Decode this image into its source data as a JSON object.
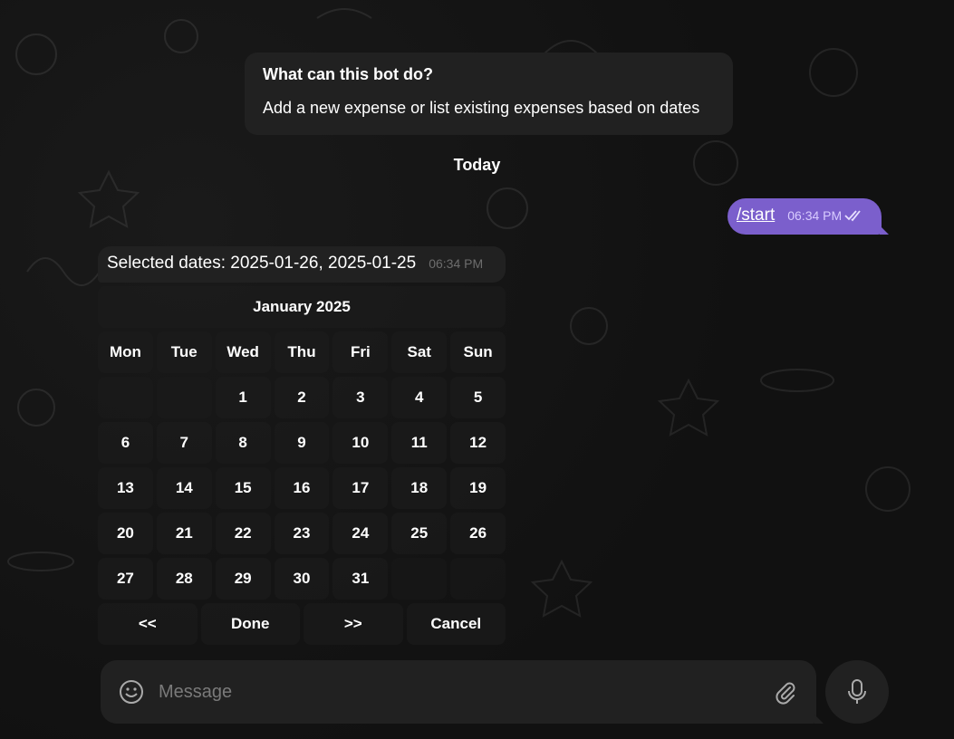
{
  "bot_intro": {
    "title": "What can this bot do?",
    "text": "Add a new expense or list existing expenses based on dates"
  },
  "date_separator": "Today",
  "outgoing_message": {
    "text": "/start",
    "time": "06:34 PM",
    "status": "read"
  },
  "incoming_message": {
    "text": "Selected dates: 2025-01-26, 2025-01-25",
    "time": "06:34 PM"
  },
  "calendar": {
    "month_label": "January 2025",
    "weekdays": [
      "Mon",
      "Tue",
      "Wed",
      "Thu",
      "Fri",
      "Sat",
      "Sun"
    ],
    "weeks": [
      [
        "",
        "",
        "1",
        "2",
        "3",
        "4",
        "5"
      ],
      [
        "6",
        "7",
        "8",
        "9",
        "10",
        "11",
        "12"
      ],
      [
        "13",
        "14",
        "15",
        "16",
        "17",
        "18",
        "19"
      ],
      [
        "20",
        "21",
        "22",
        "23",
        "24",
        "25",
        "26"
      ],
      [
        "27",
        "28",
        "29",
        "30",
        "31",
        "",
        ""
      ]
    ],
    "nav": {
      "prev": "<<",
      "done": "Done",
      "next": ">>",
      "cancel": "Cancel"
    }
  },
  "composer": {
    "placeholder": "Message",
    "value": ""
  },
  "colors": {
    "accent": "#7b5fcc",
    "bubble": "#212121",
    "background": "#0f0f0f"
  },
  "icons": {
    "emoji": "smile-icon",
    "attach": "paperclip-icon",
    "mic": "microphone-icon",
    "read_status": "double-check-icon"
  }
}
